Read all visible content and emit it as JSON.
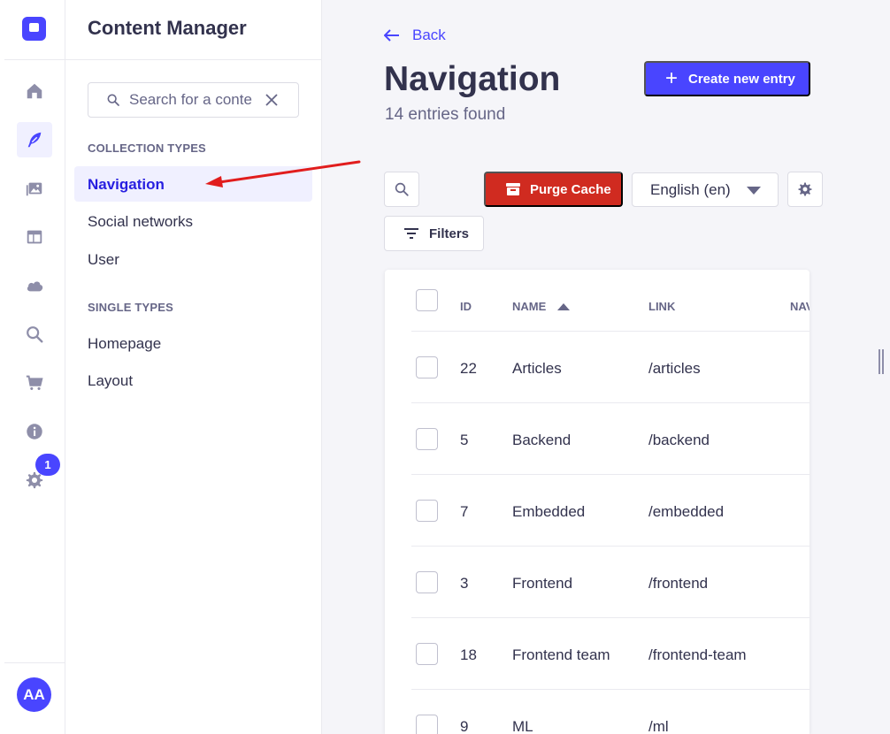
{
  "rail": {
    "items": [
      {
        "name": "home-icon",
        "active": false
      },
      {
        "name": "content-manager-icon",
        "active": true
      },
      {
        "name": "media-library-icon",
        "active": false
      },
      {
        "name": "content-type-builder-icon",
        "active": false
      },
      {
        "name": "cloud-icon",
        "active": false
      },
      {
        "name": "search-icon",
        "active": false
      },
      {
        "name": "cart-icon",
        "active": false
      },
      {
        "name": "info-icon",
        "active": false
      },
      {
        "name": "settings-icon",
        "active": false
      }
    ],
    "settings_badge": "1",
    "avatar_initials": "AA"
  },
  "sidebar": {
    "title": "Content Manager",
    "search_placeholder": "Search for a conte",
    "collection_header": "COLLECTION TYPES",
    "collection_items": [
      "Navigation",
      "Social networks",
      "User"
    ],
    "single_header": "SINGLE TYPES",
    "single_items": [
      "Homepage",
      "Layout"
    ]
  },
  "main": {
    "back_label": "Back",
    "title": "Navigation",
    "subtitle": "14 entries found",
    "create_label": "Create new entry",
    "purge_label": "Purge Cache",
    "locale_value": "English (en)",
    "filters_label": "Filters"
  },
  "table": {
    "headers": {
      "id": "ID",
      "name": "NAME",
      "link": "LINK",
      "nav": "NAV"
    },
    "sort_column": "NAME",
    "rows": [
      {
        "id": "22",
        "name": "Articles",
        "link": "/articles"
      },
      {
        "id": "5",
        "name": "Backend",
        "link": "/backend"
      },
      {
        "id": "7",
        "name": "Embedded",
        "link": "/embedded"
      },
      {
        "id": "3",
        "name": "Frontend",
        "link": "/frontend"
      },
      {
        "id": "18",
        "name": "Frontend team",
        "link": "/frontend-team"
      },
      {
        "id": "9",
        "name": "ML",
        "link": "/ml"
      }
    ]
  },
  "colors": {
    "primary": "#4945ff",
    "danger": "#d02b20",
    "annotation_arrow": "#e11d1d"
  }
}
